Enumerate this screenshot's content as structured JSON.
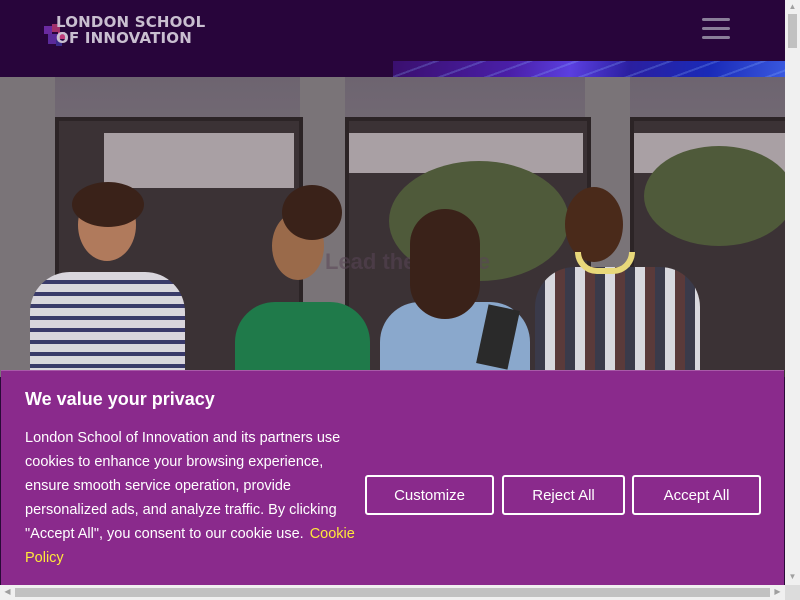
{
  "header": {
    "logo_line1": "LONDON SCHOOL",
    "logo_line2": "OF INNOVATION",
    "menu_icon": "hamburger-icon"
  },
  "hero": {
    "faded_text": "Lead the Future",
    "image_subject": "four smiling students walking in front of a building"
  },
  "cookie": {
    "title": "We value your privacy",
    "body": "London School of Innovation and its partners use cookies to enhance your browsing experience, ensure smooth service operation, provide personalized ads, and analyze traffic. By clicking \"Accept All\", you consent to our cookie use.",
    "policy_link": "Cookie Policy",
    "customize_label": "Customize",
    "reject_label": "Reject All",
    "accept_label": "Accept All"
  },
  "colors": {
    "header_bg": "#28053b",
    "cookie_bg": "#8a2a8c",
    "link": "#ffe83a",
    "logo_text": "#c9bfd0"
  },
  "scroll": {
    "up_arrow": "▲",
    "down_arrow": "▼",
    "left_arrow": "◀",
    "right_arrow": "▶"
  }
}
